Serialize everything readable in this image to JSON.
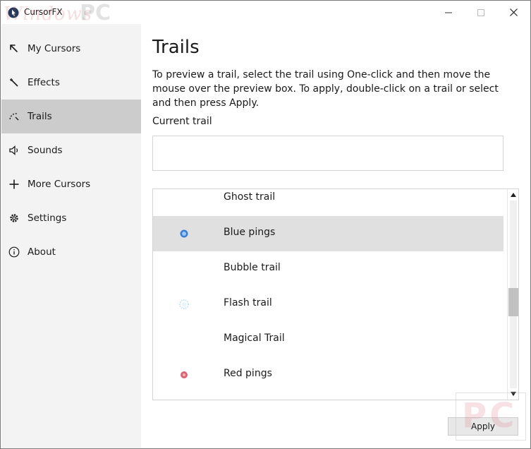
{
  "window": {
    "title": "CursorFX",
    "watermark_text": "WindowsPC",
    "watermark_prefix": "Windows",
    "watermark_suffix": "PC"
  },
  "sidebar": {
    "items": [
      {
        "label": "My Cursors",
        "icon": "cursor-arrow-icon",
        "selected": false
      },
      {
        "label": "Effects",
        "icon": "magic-wand-icon",
        "selected": false
      },
      {
        "label": "Trails",
        "icon": "trail-dots-icon",
        "selected": true
      },
      {
        "label": "Sounds",
        "icon": "speaker-icon",
        "selected": false
      },
      {
        "label": "More Cursors",
        "icon": "plus-icon",
        "selected": false
      },
      {
        "label": "Settings",
        "icon": "gear-icon",
        "selected": false
      },
      {
        "label": "About",
        "icon": "info-icon",
        "selected": false
      }
    ]
  },
  "main": {
    "title": "Trails",
    "description": "To preview a trail, select the trail using One-click and then move the mouse over the preview box. To apply, double-click on a trail or select and then press Apply.",
    "current_trail_label": "Current trail",
    "trails": [
      {
        "name": "Ghost trail",
        "selected": false
      },
      {
        "name": "Blue pings",
        "selected": true
      },
      {
        "name": "Bubble trail",
        "selected": false
      },
      {
        "name": "Flash trail",
        "selected": false
      },
      {
        "name": "Magical Trail",
        "selected": false
      },
      {
        "name": "Red pings",
        "selected": false
      }
    ],
    "apply_label": "Apply"
  },
  "bottom_watermark": "PC",
  "colors": {
    "sidebar_bg": "#f3f3f3",
    "sidebar_selected": "#cccccc",
    "list_selected": "#e0e0e0",
    "blue_ping": "#3a7fd5",
    "red_ping": "#d24a5a"
  }
}
